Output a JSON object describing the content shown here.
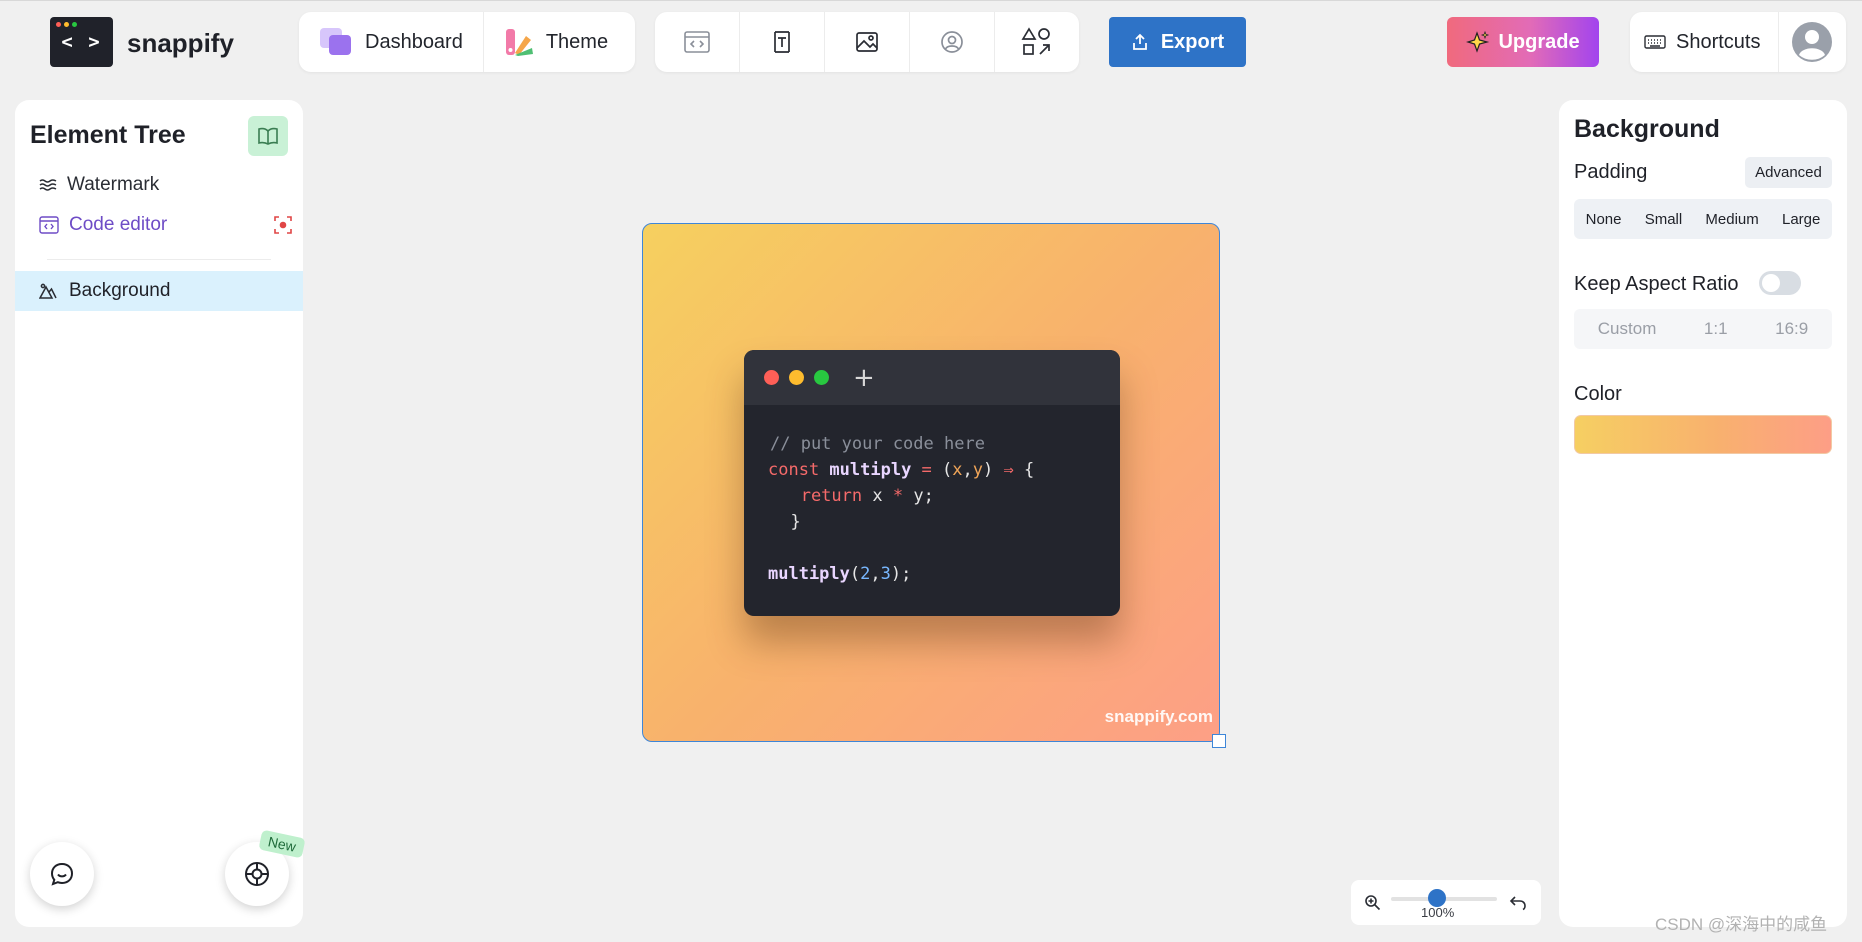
{
  "app": {
    "logo_glyph": "< >",
    "brand": "snappify"
  },
  "nav": {
    "dashboard_label": "Dashboard",
    "theme_label": "Theme"
  },
  "toolbar": {
    "tools": [
      "code-window-icon",
      "text-icon",
      "image-icon",
      "avatar-icon",
      "shapes-icon"
    ]
  },
  "export_label": "Export",
  "upgrade_label": "Upgrade",
  "shortcuts_label": "Shortcuts",
  "element_tree": {
    "title": "Element Tree",
    "items": [
      {
        "label": "Watermark",
        "icon": "waves-icon"
      },
      {
        "label": "Code editor",
        "icon": "code-window-icon"
      }
    ],
    "selected": {
      "label": "Background",
      "icon": "mountain-icon"
    },
    "new_badge": "New"
  },
  "canvas": {
    "watermark": "snappify.com",
    "code_lines": [
      [
        {
          "t": "// put your code here",
          "c": "comment"
        }
      ],
      [
        {
          "t": "const ",
          "c": "kw"
        },
        {
          "t": "multiply",
          "c": "fn"
        },
        {
          "t": " = ",
          "c": "kw"
        },
        {
          "t": "(",
          "c": "punc"
        },
        {
          "t": "x",
          "c": "param"
        },
        {
          "t": ",",
          "c": "punc"
        },
        {
          "t": "y",
          "c": "param"
        },
        {
          "t": ") ",
          "c": "punc"
        },
        {
          "t": "⇒",
          "c": "kw"
        },
        {
          "t": " {",
          "c": "punc"
        }
      ],
      [
        {
          "t": "   return ",
          "c": "kw"
        },
        {
          "t": "x ",
          "c": "punc"
        },
        {
          "t": "*",
          "c": "kw"
        },
        {
          "t": " y;",
          "c": "punc"
        }
      ],
      [
        {
          "t": "  }",
          "c": "punc"
        }
      ],
      [
        {
          "t": "",
          "c": "punc"
        }
      ],
      [
        {
          "t": "multiply",
          "c": "fn"
        },
        {
          "t": "(",
          "c": "punc"
        },
        {
          "t": "2",
          "c": "num"
        },
        {
          "t": ",",
          "c": "punc"
        },
        {
          "t": "3",
          "c": "num"
        },
        {
          "t": ");",
          "c": "punc"
        }
      ]
    ],
    "traffic_colors": [
      "#fe5f57",
      "#febc2e",
      "#28c840"
    ]
  },
  "zoom": {
    "label": "100%",
    "level": 1.0
  },
  "background_panel": {
    "title": "Background",
    "padding_label": "Padding",
    "advanced_label": "Advanced",
    "padding_options": [
      "None",
      "Small",
      "Medium",
      "Large"
    ],
    "aspect_label": "Keep Aspect Ratio",
    "aspect_enabled": false,
    "aspect_options": [
      "Custom",
      "1:1",
      "16:9"
    ],
    "color_label": "Color",
    "gradient": [
      "#f6cf62",
      "#f8b16e",
      "#fd9e86"
    ]
  },
  "colors": {
    "accent": "#2e73c7",
    "selected_row": "#daf1fd",
    "code_bg": "#23252d"
  },
  "footer_watermark": "CSDN @深海中的咸鱼"
}
